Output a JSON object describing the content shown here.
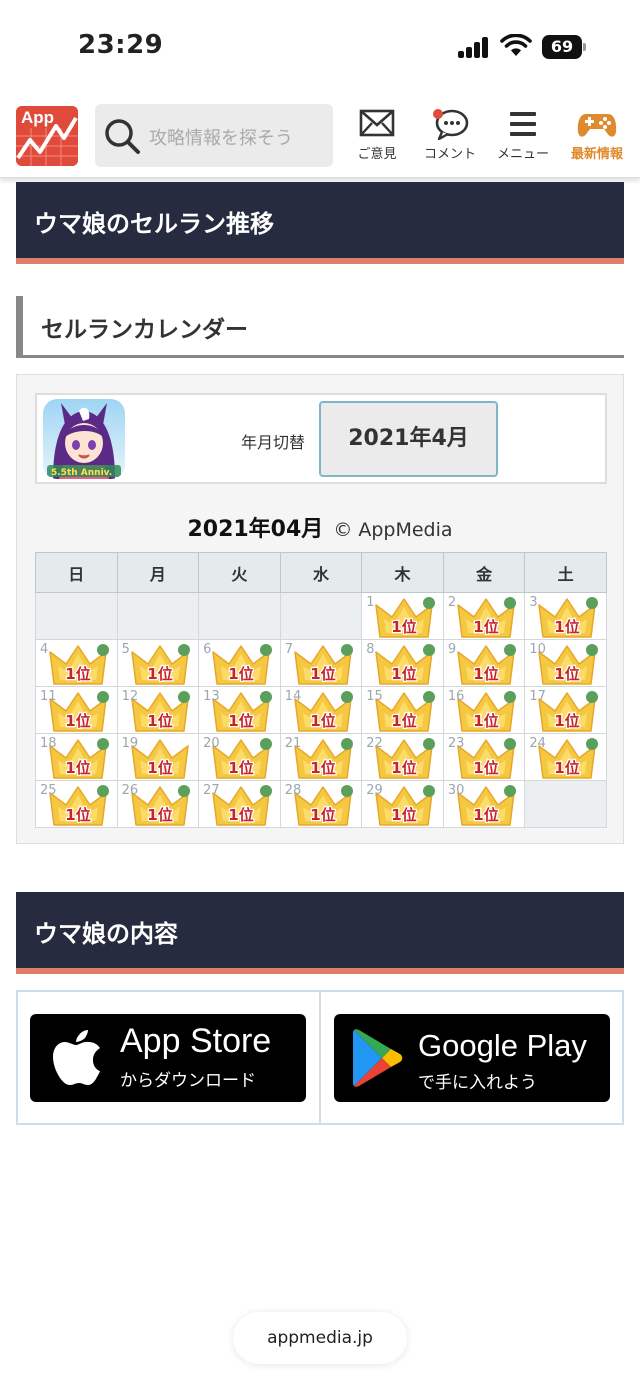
{
  "status_bar": {
    "time": "23:29",
    "battery": "69"
  },
  "header": {
    "logo_text": "App",
    "search_placeholder": "攻略情報を探そう",
    "nav": [
      {
        "label": "ご意見",
        "icon": "mail-icon"
      },
      {
        "label": "コメント",
        "icon": "comment-icon"
      },
      {
        "label": "メニュー",
        "icon": "menu-icon"
      },
      {
        "label": "最新情報",
        "icon": "gamepad-icon"
      }
    ],
    "accent_color": "#e08a2e"
  },
  "sections": {
    "ranking_title": "ウマ娘のセルラン推移",
    "calendar_subtitle": "セルランカレンダー",
    "content_title": "ウマ娘の内容"
  },
  "calendar": {
    "switch_label": "年月切替",
    "selected_month": "2021年4月",
    "title": "2021年04月",
    "credit": "© AppMedia",
    "weekdays": [
      "日",
      "月",
      "火",
      "水",
      "木",
      "金",
      "土"
    ],
    "rank_label": "1位",
    "rank_badge_icon": "crown-icon",
    "days": [
      "1",
      "2",
      "3",
      "4",
      "5",
      "6",
      "7",
      "8",
      "9",
      "10",
      "11",
      "12",
      "13",
      "14",
      "15",
      "16",
      "17",
      "18",
      "19",
      "20",
      "21",
      "22",
      "23",
      "24",
      "25",
      "26",
      "27",
      "28",
      "29",
      "30"
    ],
    "green_dot_days": [
      "1",
      "2",
      "3",
      "4",
      "5",
      "6",
      "7",
      "8",
      "9",
      "10",
      "11",
      "12",
      "13",
      "14",
      "15",
      "16",
      "17",
      "18",
      "20",
      "21",
      "22",
      "23",
      "24",
      "25",
      "26",
      "27",
      "28",
      "29",
      "30"
    ]
  },
  "stores": {
    "app_store": {
      "title": "App Store",
      "subtitle": "からダウンロード"
    },
    "google_play": {
      "title": "Google Play",
      "subtitle": "で手に入れよう"
    }
  },
  "url_bar": "appmedia.jp",
  "colors": {
    "heading_bg": "#262b40",
    "heading_underline": "#e07c6a",
    "green_dot": "#5aa05c",
    "crown": "#f5c842"
  }
}
